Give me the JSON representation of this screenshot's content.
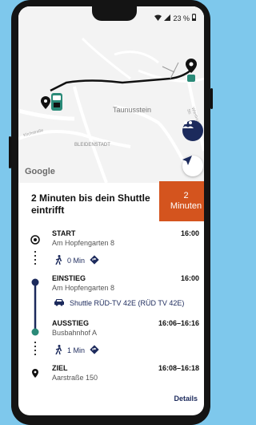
{
  "status_bar": {
    "battery": "23 %"
  },
  "map": {
    "labels": {
      "taunusstein": "Taunusstein",
      "bleidenstadt": "BLEIDENSTADT",
      "kirchstrasse": "Kirchstraße",
      "wiesbadener": "Wiesbadener Str."
    },
    "attribution": "Google"
  },
  "eta": {
    "value": "2",
    "unit": "Minuten"
  },
  "header": {
    "title": "2 Minuten bis dein Shuttle eintrifft"
  },
  "timeline": {
    "start": {
      "label": "START",
      "address": "Am Hopfengarten 8",
      "time": "16:00"
    },
    "walk1": {
      "duration": "0 Min"
    },
    "einstieg": {
      "label": "EINSTIEG",
      "address": "Am Hopfengarten 8",
      "time": "16:00"
    },
    "shuttle": {
      "label": "Shuttle RÜD-TV 42E (RÜD TV 42E)"
    },
    "ausstieg": {
      "label": "AUSSTIEG",
      "address": "Busbahnhof A",
      "time": "16:06–16:16"
    },
    "walk2": {
      "duration": "1 Min"
    },
    "ziel": {
      "label": "ZIEL",
      "address": "Aarstraße 150",
      "time": "16:08–16:18"
    }
  },
  "footer": {
    "details_label": "Details"
  },
  "colors": {
    "accent_orange": "#d4541e",
    "navy": "#1c2a5c",
    "teal": "#2a8a78"
  }
}
